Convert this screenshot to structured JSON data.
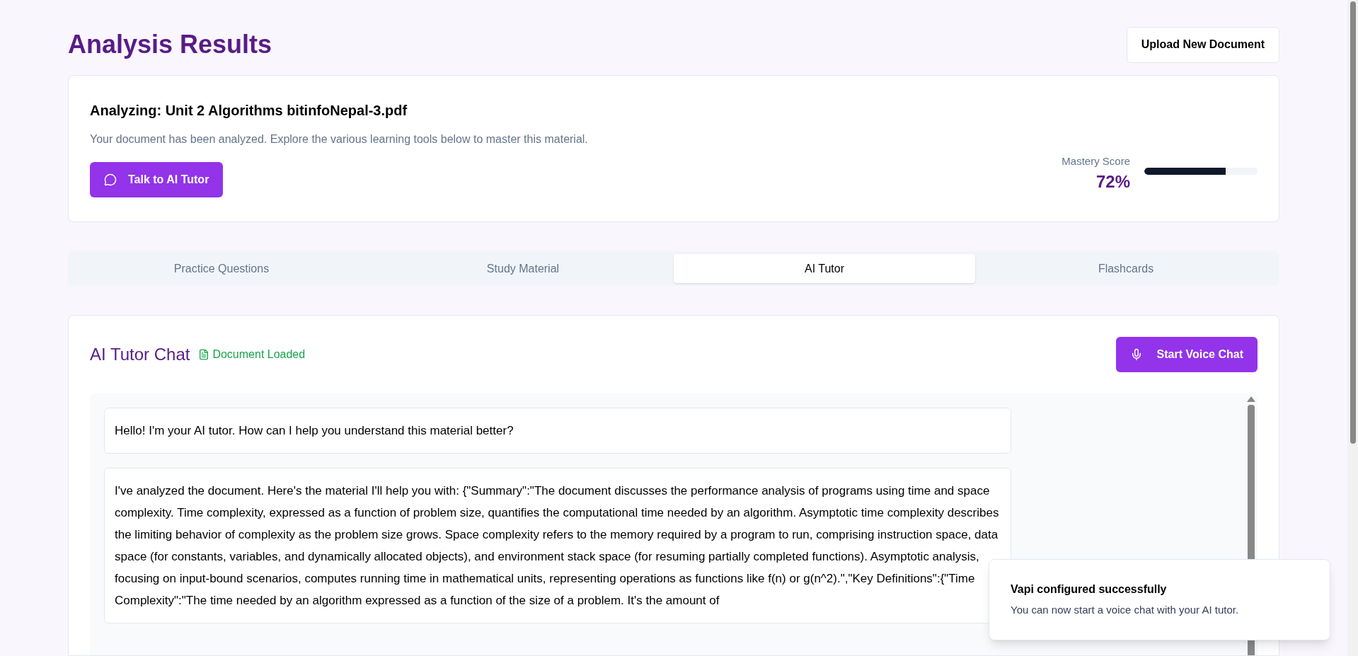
{
  "header": {
    "title": "Analysis Results",
    "upload_button": "Upload New Document"
  },
  "summary": {
    "title": "Analyzing: Unit 2 Algorithms bitinfoNepal-3.pdf",
    "description": "Your document has been analyzed. Explore the various learning tools below to master this material.",
    "tutor_button": "Talk to AI Tutor",
    "mastery": {
      "label": "Mastery Score",
      "value": "72%",
      "level": 0.72
    }
  },
  "tabs": [
    {
      "label": "Practice Questions",
      "selected": false
    },
    {
      "label": "Study Material",
      "selected": false
    },
    {
      "label": "AI Tutor",
      "selected": true
    },
    {
      "label": "Flashcards",
      "selected": false
    }
  ],
  "chat": {
    "title": "AI Tutor Chat",
    "status": "Document Loaded",
    "voice_button": "Start Voice Chat",
    "messages": [
      {
        "text": "Hello! I'm your AI tutor. How can I help you understand this material better?"
      },
      {
        "text": "I've analyzed the document. Here's the material I'll help you with: {\"Summary\":\"The document discusses the performance analysis of programs using time and space complexity. Time complexity, expressed as a function of problem size, quantifies the computational time needed by an algorithm. Asymptotic time complexity describes the limiting behavior of complexity as the problem size grows. Space complexity refers to the memory required by a program to run, comprising instruction space, data space (for constants, variables, and dynamically allocated objects), and environment stack space (for resuming partially completed functions). Asymptotic analysis, focusing on input-bound scenarios, computes running time in mathematical units, representing operations as functions like f(n) or g(n^2).\",\"Key Definitions\":{\"Time Complexity\":\"The time needed by an algorithm expressed as a function of the size of a problem. It's the amount of"
      }
    ]
  },
  "toast": {
    "title": "Vapi configured successfully",
    "message": "You can now start a voice chat with your AI tutor."
  }
}
